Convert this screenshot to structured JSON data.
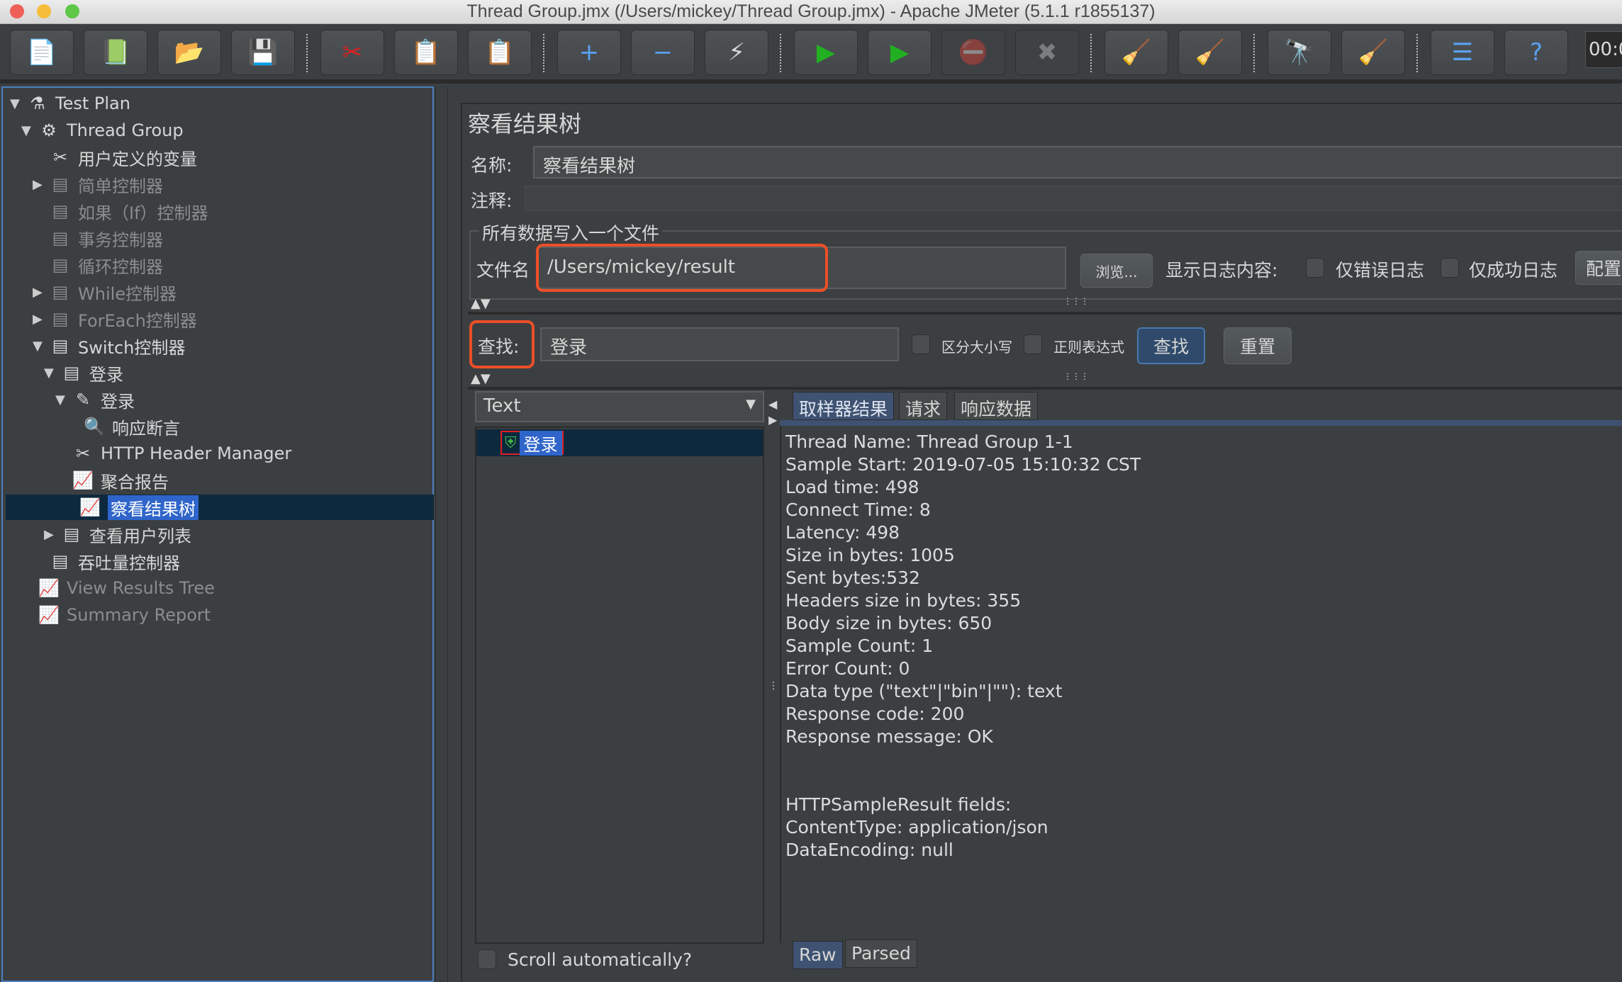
{
  "window": {
    "title": "Thread Group.jmx (/Users/mickey/Thread Group.jmx) - Apache JMeter (5.1.1 r1855137)",
    "timer": "00:0"
  },
  "toolbar": {
    "icons": [
      "new-icon",
      "templates-icon",
      "open-icon",
      "save-icon",
      "cut-icon",
      "copy-icon",
      "paste-icon",
      "expand-icon",
      "collapse-icon",
      "toggle-icon",
      "start-icon",
      "start-no-pause-icon",
      "stop-icon",
      "shutdown-icon",
      "clear-icon",
      "clear-all-icon",
      "search-icon",
      "reset-search-icon",
      "function-helper-icon",
      "help-icon"
    ]
  },
  "tree": [
    {
      "label": "Test Plan",
      "depth": 0,
      "arrow": "▼",
      "icon": "⚗",
      "state": "normal"
    },
    {
      "label": "Thread Group",
      "depth": 1,
      "arrow": "▼",
      "icon": "⚙",
      "state": "normal"
    },
    {
      "label": "用户定义的变量",
      "depth": 2,
      "arrow": "",
      "icon": "✂",
      "state": "normal"
    },
    {
      "label": "简单控制器",
      "depth": 2,
      "arrow": "▶",
      "icon": "▤",
      "state": "disabled"
    },
    {
      "label": "如果（If）控制器",
      "depth": 2,
      "arrow": "",
      "icon": "▤",
      "state": "disabled"
    },
    {
      "label": "事务控制器",
      "depth": 2,
      "arrow": "",
      "icon": "▤",
      "state": "disabled"
    },
    {
      "label": "循环控制器",
      "depth": 2,
      "arrow": "",
      "icon": "▤",
      "state": "disabled"
    },
    {
      "label": "While控制器",
      "depth": 2,
      "arrow": "▶",
      "icon": "▤",
      "state": "disabled"
    },
    {
      "label": "ForEach控制器",
      "depth": 2,
      "arrow": "▶",
      "icon": "▤",
      "state": "disabled"
    },
    {
      "label": "Switch控制器",
      "depth": 2,
      "arrow": "▼",
      "icon": "▤",
      "state": "normal"
    },
    {
      "label": "登录",
      "depth": 3,
      "arrow": "▼",
      "icon": "▤",
      "state": "normal"
    },
    {
      "label": "登录",
      "depth": 4,
      "arrow": "▼",
      "icon": "✎",
      "state": "normal"
    },
    {
      "label": "响应断言",
      "depth": 5,
      "arrow": "",
      "icon": "🔍",
      "state": "normal"
    },
    {
      "label": "HTTP Header Manager",
      "depth": 4,
      "arrow": "",
      "icon": "✂",
      "state": "normal"
    },
    {
      "label": "聚合报告",
      "depth": 4,
      "arrow": "",
      "icon": "📈",
      "state": "normal"
    },
    {
      "label": "察看结果树",
      "depth": 4,
      "arrow": "",
      "icon": "📈",
      "state": "selected"
    },
    {
      "label": "查看用户列表",
      "depth": 3,
      "arrow": "▶",
      "icon": "▤",
      "state": "normal"
    },
    {
      "label": "吞吐量控制器",
      "depth": 2,
      "arrow": "",
      "icon": "▤",
      "state": "normal"
    },
    {
      "label": "View Results Tree",
      "depth": 1,
      "arrow": "",
      "icon": "📈",
      "state": "disabled"
    },
    {
      "label": "Summary Report",
      "depth": 1,
      "arrow": "",
      "icon": "📈",
      "state": "disabled"
    }
  ],
  "panel": {
    "title": "察看结果树",
    "name_label": "名称:",
    "name_value": "察看结果树",
    "comment_label": "注释:",
    "comment_value": "",
    "file_group": "所有数据写入一个文件",
    "file_label": "文件名",
    "file_value": "/Users/mickey/result",
    "browse": "浏览...",
    "log_label": "显示日志内容:",
    "errors_only": "仅错误日志",
    "success_only": "仅成功日志",
    "configure": "配置",
    "search_label": "查找:",
    "search_value": "登录",
    "case_sensitive": "区分大小写",
    "regex": "正则表达式",
    "search_btn": "查找",
    "reset_btn": "重置",
    "renderer": "Text",
    "result_item": "登录",
    "tabs": [
      "取样器结果",
      "请求",
      "响应数据"
    ],
    "lines": [
      "Thread Name: Thread Group 1-1",
      "Sample Start: 2019-07-05 15:10:32 CST",
      "Load time: 498",
      "Connect Time: 8",
      "Latency: 498",
      "Size in bytes: 1005",
      "Sent bytes:532",
      "Headers size in bytes: 355",
      "Body size in bytes: 650",
      "Sample Count: 1",
      "Error Count: 0",
      "Data type (\"text\"|\"bin\"|\"\"): text",
      "Response code: 200",
      "Response message: OK",
      "",
      "",
      "HTTPSampleResult fields:",
      "ContentType: application/json",
      "DataEncoding: null"
    ],
    "scroll_auto": "Scroll automatically?",
    "bottom_tabs": [
      "Raw",
      "Parsed"
    ]
  },
  "colors": {
    "accent": "#2f65ca",
    "highlight": "#ec4f27",
    "background": "#3c3f41"
  }
}
